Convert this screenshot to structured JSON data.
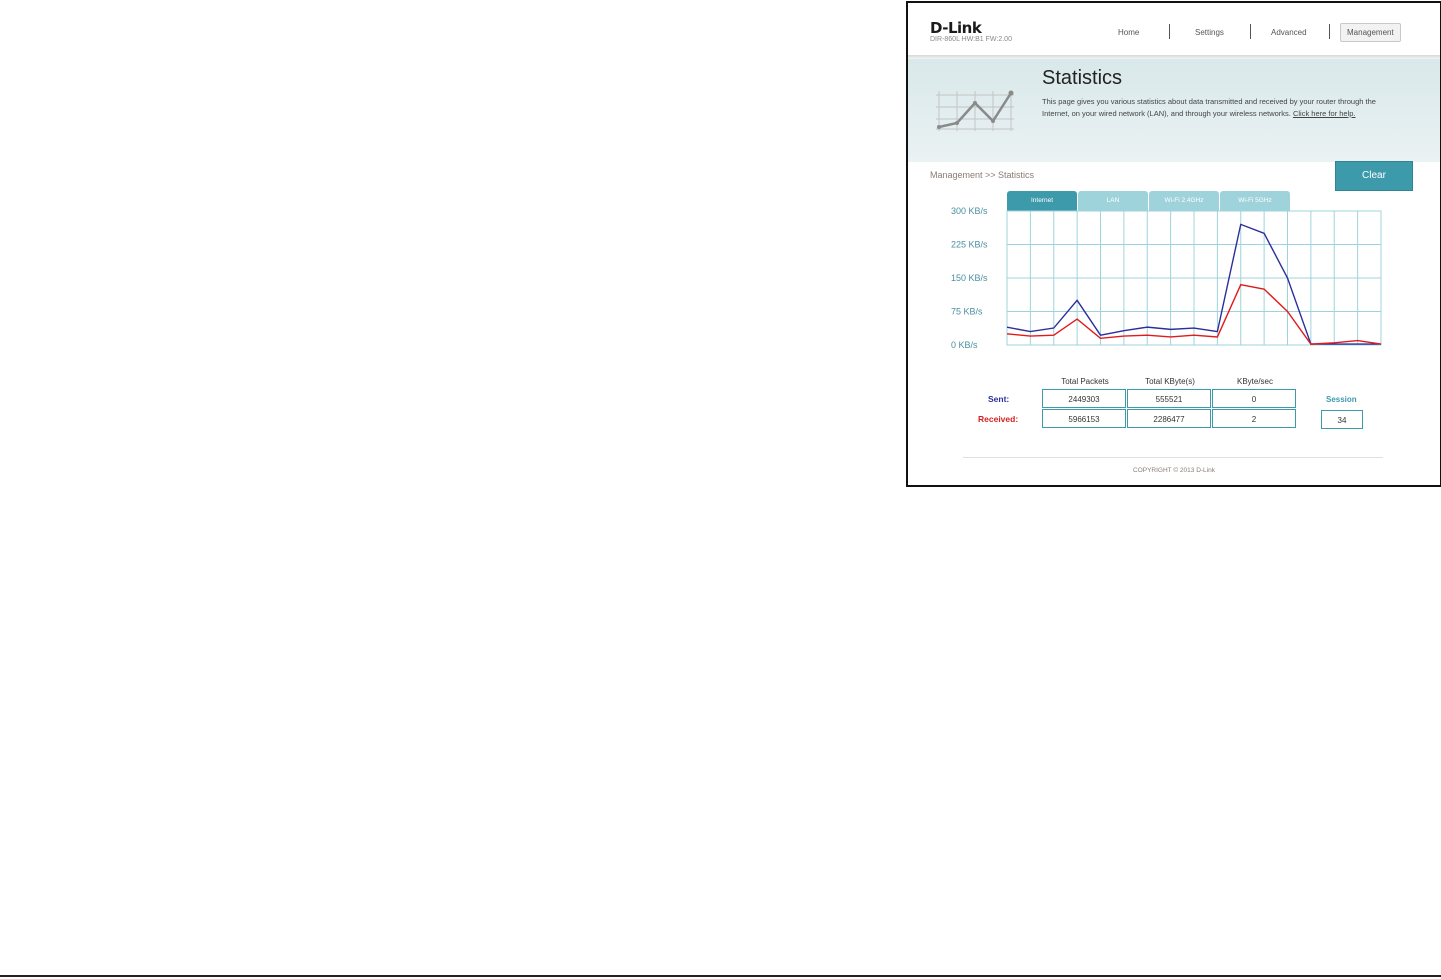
{
  "header": {
    "logo": "D-Link",
    "model": "DIR-860L   HW:B1   FW:2.00",
    "nav": [
      "Home",
      "Settings",
      "Advanced",
      "Management"
    ],
    "active_nav": "Management"
  },
  "banner": {
    "title": "Statistics",
    "description": "This page gives you various statistics about data transmitted and received by your router through the Internet, on your wired network (LAN), and through your wireless networks. ",
    "help_link": "Click here for help."
  },
  "breadcrumb": "Management >> Statistics",
  "clear_button": "Clear",
  "tabs": [
    "Internet",
    "LAN",
    "Wi-Fi 2.4GHz",
    "Wi-Fi 5GHz"
  ],
  "active_tab": "Internet",
  "colors": {
    "accent": "#3d9aab",
    "sent": "#2c2f9b",
    "received": "#e01b1b"
  },
  "chart_data": {
    "type": "line",
    "y_tick_labels": [
      "300 KB/s",
      "225 KB/s",
      "150 KB/s",
      "75 KB/s",
      "0 KB/s"
    ],
    "ylim": [
      0,
      300
    ],
    "grid": true,
    "x": [
      0,
      1,
      2,
      3,
      4,
      5,
      6,
      7,
      8,
      9,
      10,
      11,
      12,
      13,
      14,
      15,
      16
    ],
    "series": [
      {
        "values": [
          40,
          30,
          38,
          100,
          22,
          32,
          40,
          35,
          38,
          30,
          270,
          250,
          150,
          2,
          2,
          2,
          2
        ]
      },
      {
        "values": [
          25,
          20,
          22,
          58,
          15,
          20,
          22,
          18,
          22,
          18,
          135,
          125,
          75,
          2,
          5,
          10,
          2
        ]
      }
    ]
  },
  "stats": {
    "headers": [
      "Total Packets",
      "Total KByte(s)",
      "KByte/sec"
    ],
    "sent_label": "Sent:",
    "received_label": "Received:",
    "sent": [
      "2449303",
      "555521",
      "0"
    ],
    "received": [
      "5966153",
      "2286477",
      "2"
    ],
    "session_label": "Session",
    "session_value": "34"
  },
  "copyright": "COPYRIGHT © 2013 D-Link"
}
